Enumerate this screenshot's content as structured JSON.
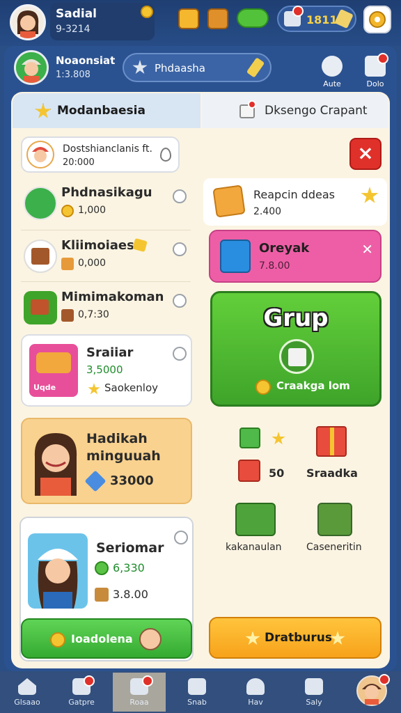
{
  "top": {
    "user_name": "Sadial",
    "user_code": "9-3214",
    "pill_value": "1811"
  },
  "profile": {
    "name": "Noaonsiat",
    "number": "1:3.808",
    "search_label": "Phdaasha",
    "btn_auto": "Aute",
    "btn_dolo": "Dolo"
  },
  "tabs": {
    "left": "Modanbaesia",
    "right": "Dksengo Crapant"
  },
  "mini_card": {
    "title": "Dostshianclanis ft.",
    "value": "20:000"
  },
  "left_list": [
    {
      "title": "Phdnasikagu",
      "value": "1,000"
    },
    {
      "title": "Kliimoiaest",
      "value": "0,000"
    },
    {
      "title": "Mimimakoman",
      "value": "0,7:30"
    }
  ],
  "card_srai": {
    "title": "Sraiiar",
    "value": "3,5000",
    "badge": "Uqde",
    "sub": "Saokenloy"
  },
  "card_hadikah": {
    "title": "Hadikah minguuah",
    "value": "33000"
  },
  "card_serio": {
    "title": "Seriomar",
    "value1": "6,330",
    "value2": "3.8.00"
  },
  "btn_green_label": "Ioadolena",
  "right": {
    "card_a": {
      "title": "Reapcin ddeas",
      "value": "2.400"
    },
    "card_pink": {
      "title": "Oreyak",
      "value": "7.8.00"
    },
    "card_green": {
      "title": "Grup",
      "sub": "Craakga lom"
    },
    "gift_count": "50",
    "gift_label": "Sraadka",
    "label_a": "kakanaulan",
    "label_b": "Caseneritin"
  },
  "btn_orange_label": "Dratburus",
  "bottom_nav": [
    {
      "label": "Glsaao"
    },
    {
      "label": "Gatpre"
    },
    {
      "label": "Roaa"
    },
    {
      "label": "Snab"
    },
    {
      "label": "Hav"
    },
    {
      "label": "Saly"
    }
  ],
  "colors": {
    "accent_green": "#3ea42a",
    "accent_pink": "#ee5ea6",
    "accent_orange": "#f7a21b",
    "danger_red": "#e0302a",
    "nav_blue": "#324f7d"
  }
}
